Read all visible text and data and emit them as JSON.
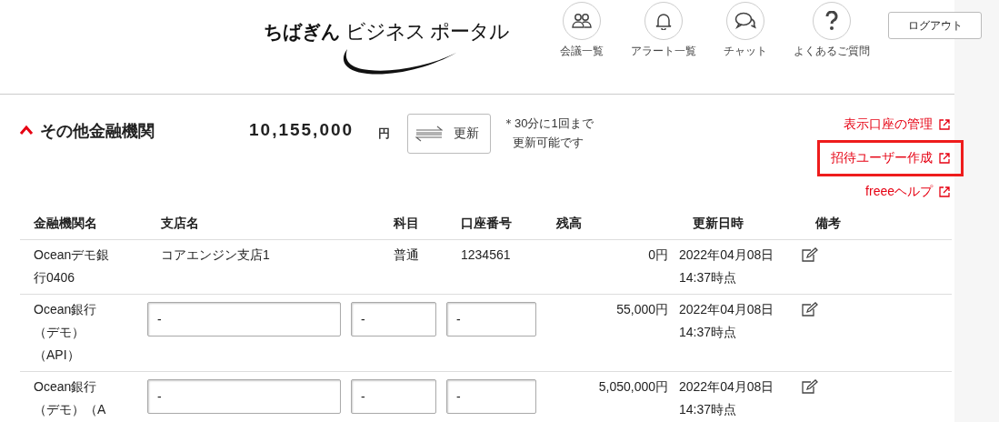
{
  "header": {
    "logo": "ちばぎん",
    "logo_sub": "ビジネス ポータル",
    "nav": [
      {
        "kind": "meetings",
        "label": "会議一覧"
      },
      {
        "kind": "alerts",
        "label": "アラート一覧"
      },
      {
        "kind": "chat",
        "label": "チャット"
      },
      {
        "kind": "faq",
        "label": "よくあるご質問"
      }
    ],
    "logout": "ログアウト"
  },
  "section": {
    "title": "その他金融機関",
    "expanded": true,
    "total": "10,155,000",
    "currency": "円",
    "refresh": "更新",
    "note": [
      "＊30分に1回まで",
      "更新可能です"
    ],
    "links": [
      {
        "label": "表示口座の管理",
        "highlighted": false
      },
      {
        "label": "招待ユーザー作成",
        "highlighted": true
      },
      {
        "label": "freeeヘルプ",
        "highlighted": false
      }
    ]
  },
  "table": {
    "columns": [
      "金融機関名",
      "支店名",
      "科目",
      "口座番号",
      "残高",
      "更新日時",
      "備考"
    ],
    "rows": [
      {
        "kind": "text",
        "bank": "Oceanデモ銀行0406",
        "branch": "コアエンジン支店1",
        "subject": "普通",
        "account": "1234561",
        "balance": "0円",
        "updated": [
          "2022年04月08日",
          "14:37時点"
        ]
      },
      {
        "kind": "input",
        "bank": "Ocean銀行（デモ）（API）",
        "branch": "-",
        "subject": "-",
        "account": "-",
        "balance": "55,000円",
        "updated": [
          "2022年04月08日",
          "14:37時点"
        ]
      },
      {
        "kind": "input",
        "bank": "Ocean銀行（デモ）（A",
        "branch": "-",
        "subject": "-",
        "account": "-",
        "balance": "5,050,000円",
        "updated": [
          "2022年04月08日",
          "14:37時点"
        ]
      }
    ]
  }
}
